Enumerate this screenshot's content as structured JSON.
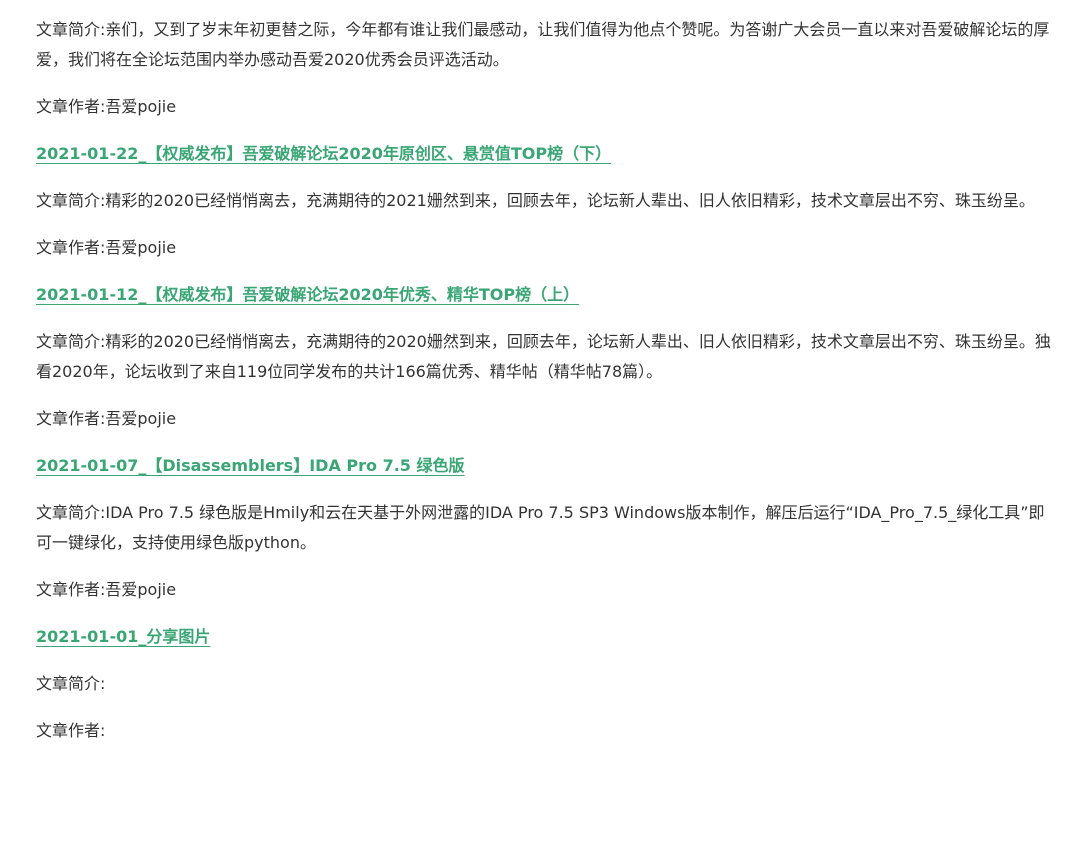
{
  "entries": [
    {
      "title": "",
      "summary": "文章简介:亲们，又到了岁末年初更替之际，今年都有谁让我们最感动，让我们值得为他点个赞呢。为答谢广大会员一直以来对吾爱破解论坛的厚爱，我们将在全论坛范围内举办感动吾爱2020优秀会员评选活动。",
      "author": "文章作者:吾爱pojie"
    },
    {
      "title": "2021-01-22_【权威发布】吾爱破解论坛2020年原创区、悬赏值TOP榜（下）",
      "summary": "文章简介:精彩的2020已经悄悄离去，充满期待的2021姗然到来，回顾去年，论坛新人辈出、旧人依旧精彩，技术文章层出不穷、珠玉纷呈。",
      "author": "文章作者:吾爱pojie"
    },
    {
      "title": "2021-01-12_【权威发布】吾爱破解论坛2020年优秀、精华TOP榜（上）",
      "summary": "文章简介:精彩的2020已经悄悄离去，充满期待的2020姗然到来，回顾去年，论坛新人辈出、旧人依旧精彩，技术文章层出不穷、珠玉纷呈。独看2020年，论坛收到了来自119位同学发布的共计166篇优秀、精华帖（精华帖78篇）。",
      "author": "文章作者:吾爱pojie"
    },
    {
      "title": "2021-01-07_【Disassemblers】IDA Pro 7.5 绿色版",
      "summary": "文章简介:IDA Pro 7.5 绿色版是Hmily和云在天基于外网泄露的IDA Pro 7.5 SP3 Windows版本制作，解压后运行“IDA_Pro_7.5_绿化工具”即可一键绿化，支持使用绿色版python。",
      "author": "文章作者:吾爱pojie"
    },
    {
      "title": "2021-01-01_分享图片",
      "summary": "文章简介:",
      "author": "文章作者:"
    }
  ],
  "colors": {
    "link": "#3aa675",
    "text": "#333333",
    "background": "#ffffff"
  }
}
